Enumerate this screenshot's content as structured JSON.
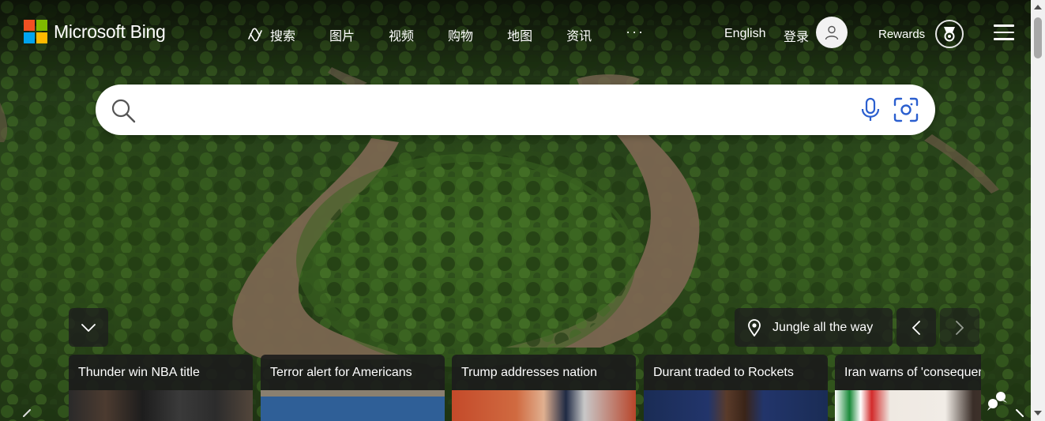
{
  "brand": {
    "name": "Microsoft Bing",
    "logo_colors": [
      "#f25022",
      "#7fba00",
      "#00a4ef",
      "#ffb900"
    ]
  },
  "nav": {
    "items": [
      {
        "label": "搜索",
        "icon": "copilot-icon"
      },
      {
        "label": "图片"
      },
      {
        "label": "视频"
      },
      {
        "label": "购物"
      },
      {
        "label": "地图"
      },
      {
        "label": "资讯"
      }
    ],
    "more_label": "···"
  },
  "header": {
    "language": "English",
    "signin": "登录",
    "rewards": "Rewards"
  },
  "search": {
    "value": "",
    "placeholder": "",
    "accent": "#2b5fcf"
  },
  "image_of_day": {
    "title": "Jungle all the way"
  },
  "news": [
    {
      "title": "Thunder win NBA title"
    },
    {
      "title": "Terror alert for Americans"
    },
    {
      "title": "Trump addresses nation"
    },
    {
      "title": "Durant traded to Rockets"
    },
    {
      "title": "Iran warns of 'consequences'"
    }
  ]
}
